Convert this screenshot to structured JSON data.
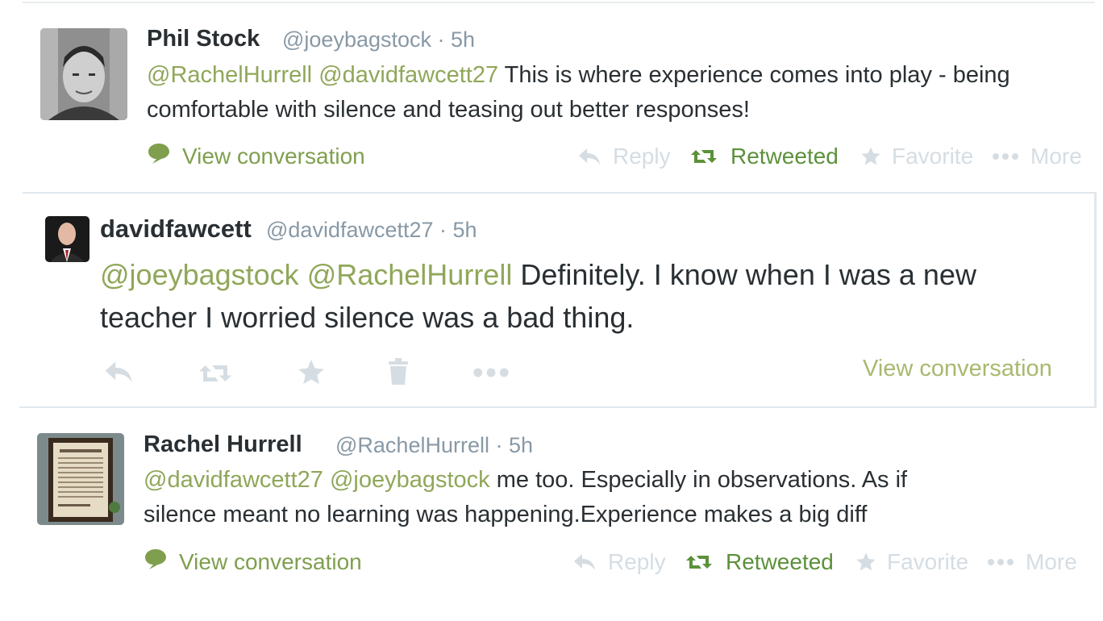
{
  "tweets": [
    {
      "name": "Phil Stock",
      "handle": "@joeybagstock",
      "time": "· 5h",
      "mentions": [
        "@RachelHurrell",
        "@davidfawcett27"
      ],
      "body": "This is where experience comes into play - being comfortable with silence and teasing out better responses!",
      "view_conversation": "View conversation",
      "reply": "Reply",
      "retweet": "Retweeted",
      "favorite": "Favorite",
      "more": "More"
    },
    {
      "name": "davidfawcett",
      "handle": "@davidfawcett27",
      "time": "· 5h",
      "mentions": [
        "@joeybagstock",
        "@RachelHurrell"
      ],
      "body_line1": "Definitely. I know when I was a new",
      "body_line2": "teacher I worried silence was a bad thing.",
      "view_conversation": "View conversation"
    },
    {
      "name": "Rachel Hurrell",
      "handle": "@RachelHurrell",
      "time": "· 5h",
      "mentions": [
        "@davidfawcett27",
        "@joeybagstock"
      ],
      "body_line1": "me too. Especially in observations. As if",
      "body_line2": "silence meant no learning was happening.Experience makes a big diff",
      "view_conversation": "View conversation",
      "reply": "Reply",
      "retweet": "Retweeted",
      "favorite": "Favorite",
      "more": "More"
    }
  ],
  "colors": {
    "mention": "#90a75a",
    "retweeted": "#5c913b",
    "muted_action": "#d5dde3",
    "meta": "#8899a6"
  },
  "icons": [
    "speech-bubble-icon",
    "reply-icon",
    "retweet-icon",
    "star-icon",
    "ellipsis-icon",
    "trash-icon"
  ]
}
